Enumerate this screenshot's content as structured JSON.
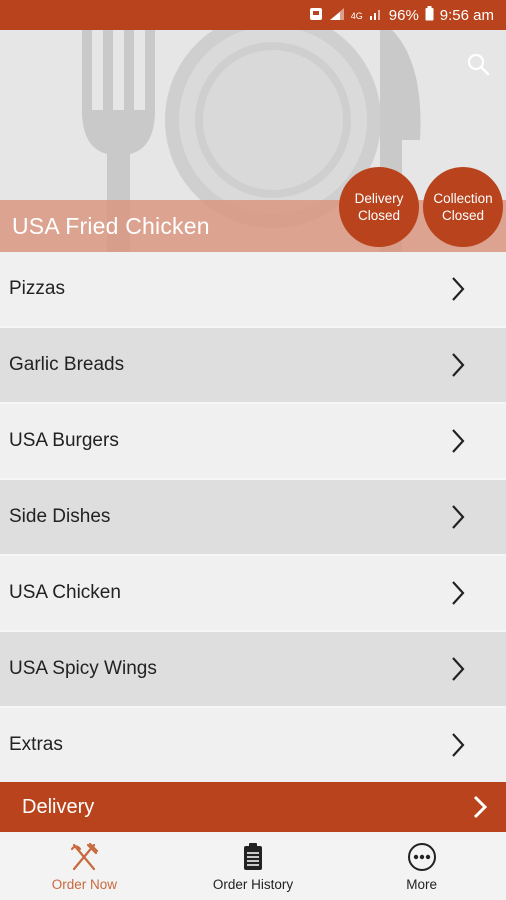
{
  "status_bar": {
    "battery": "96%",
    "time": "9:56 am",
    "network": "4G"
  },
  "restaurant": {
    "name": "USA Fried Chicken"
  },
  "badges": {
    "delivery": {
      "line1": "Delivery",
      "line2": "Closed"
    },
    "collection": {
      "line1": "Collection",
      "line2": "Closed"
    }
  },
  "menu": {
    "items": [
      {
        "label": "Pizzas"
      },
      {
        "label": "Garlic Breads"
      },
      {
        "label": "USA Burgers"
      },
      {
        "label": "Side Dishes"
      },
      {
        "label": "USA Chicken"
      },
      {
        "label": "USA Spicy Wings"
      },
      {
        "label": "Extras"
      }
    ]
  },
  "delivery_bar": {
    "label": "Delivery"
  },
  "tabs": [
    {
      "label": "Order Now",
      "icon": "fork-knife-icon",
      "active": true
    },
    {
      "label": "Order History",
      "icon": "clipboard-icon",
      "active": false
    },
    {
      "label": "More",
      "icon": "more-dots-icon",
      "active": false
    }
  ],
  "colors": {
    "brand": "#b8431c",
    "active_tab": "#c8693f"
  }
}
